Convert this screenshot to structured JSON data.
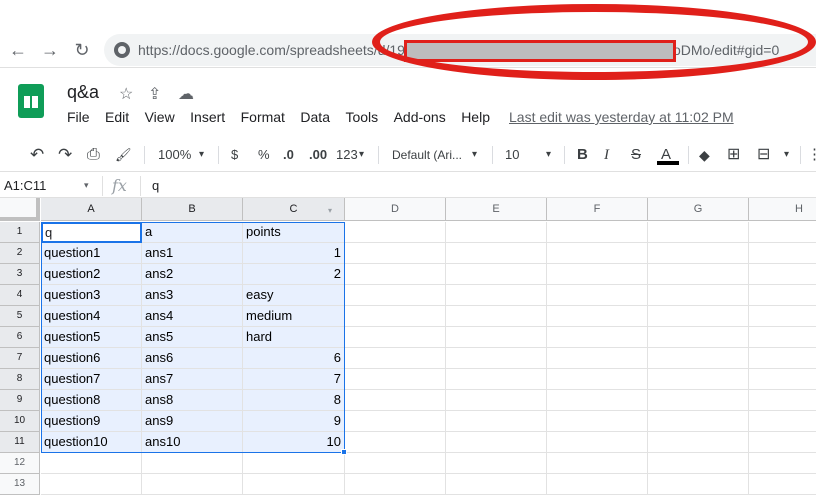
{
  "browser": {
    "back_icon": "←",
    "forward_icon": "→",
    "reload_icon": "↻",
    "url_prefix": "https://docs.google.com/spreadsheets/d/19",
    "url_suffix": "oDMo/edit#gid=0"
  },
  "sheet": {
    "title": "q&a",
    "star_icon": "☆",
    "move_icon": "⇪",
    "cloud_icon": "☁",
    "menu": [
      "File",
      "Edit",
      "View",
      "Insert",
      "Format",
      "Data",
      "Tools",
      "Add-ons",
      "Help"
    ],
    "last_edit": "Last edit was yesterday at 11:02 PM"
  },
  "toolbar": {
    "undo": "↶",
    "redo": "↷",
    "print": "⎙",
    "paint": "🖌",
    "zoom": "100%",
    "currency": "$",
    "percent": "%",
    "dec_decrease": ".0",
    "dec_increase": ".00",
    "more_formats": "123",
    "font": "Default (Ari...",
    "font_size": "10",
    "bold": "B",
    "italic": "I",
    "strike": "S",
    "font_color": "A",
    "fill": "◆",
    "borders": "⊞",
    "merge": "⊟",
    "more": "⋮",
    "dropdown": "▾"
  },
  "formula_bar": {
    "name_box": "A1:C11",
    "fx": "fx",
    "value": "q"
  },
  "grid": {
    "columns": [
      "A",
      "B",
      "C",
      "D",
      "E",
      "F",
      "G",
      "H"
    ],
    "rows": [
      "1",
      "2",
      "3",
      "4",
      "5",
      "6",
      "7",
      "8",
      "9",
      "10",
      "11",
      "12",
      "13"
    ],
    "data": [
      [
        "q",
        "a",
        "points"
      ],
      [
        "question1",
        "ans1",
        "1"
      ],
      [
        "question2",
        "ans2",
        "2"
      ],
      [
        "question3",
        "ans3",
        "easy"
      ],
      [
        "question4",
        "ans4",
        "medium"
      ],
      [
        "question5",
        "ans5",
        "hard"
      ],
      [
        "question6",
        "ans6",
        "6"
      ],
      [
        "question7",
        "ans7",
        "7"
      ],
      [
        "question8",
        "ans8",
        "8"
      ],
      [
        "question9",
        "ans9",
        "9"
      ],
      [
        "question10",
        "ans10",
        "10"
      ]
    ]
  },
  "colors": {
    "selection": "#1a73e8",
    "selection_fill": "#e8f0fe",
    "redaction": "#e0201a",
    "sheets_green": "#0f9d58"
  }
}
